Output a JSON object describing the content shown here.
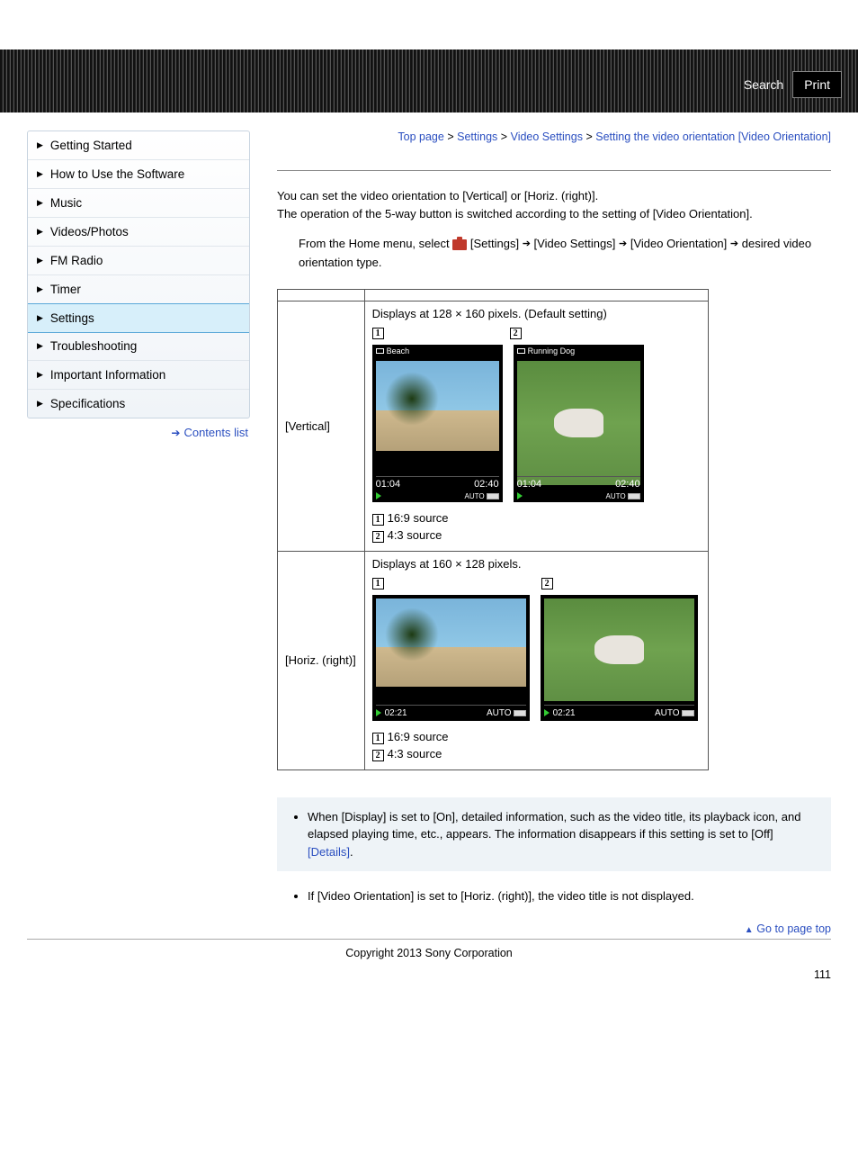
{
  "header": {
    "search": "Search",
    "print": "Print"
  },
  "breadcrumb": {
    "top": "Top page",
    "l1": "Settings",
    "l2": "Video Settings",
    "current": "Setting the video orientation [Video Orientation]",
    "sep": ">"
  },
  "sidebar": {
    "items": [
      "Getting Started",
      "How to Use the Software",
      "Music",
      "Videos/Photos",
      "FM Radio",
      "Timer",
      "Settings",
      "Troubleshooting",
      "Important Information",
      "Specifications"
    ],
    "active_index": 6,
    "contents_list": "Contents list"
  },
  "intro": {
    "l1": "You can set the video orientation to [Vertical] or [Horiz. (right)].",
    "l2": "The operation of the 5-way button is switched according to the setting of [Video Orientation]."
  },
  "step": {
    "p1": "From the Home menu, select ",
    "s1": "[Settings]",
    "s2": "[Video Settings]",
    "s3": "[Video Orientation]",
    "p2": "desired video orientation type."
  },
  "table": {
    "row1_label": "[Vertical]",
    "row1_desc": "Displays at 128 × 160 pixels. (Default setting)",
    "row2_label": "[Horiz. (right)]",
    "row2_desc": "Displays at 160 × 128 pixels.",
    "num1": "1",
    "num2": "2",
    "t_beach": "Beach",
    "t_dog": "Running Dog",
    "time_cur": "01:04",
    "time_tot": "02:40",
    "time_h": "02:21",
    "auto": "AUTO",
    "legend1": "16:9 source",
    "legend2": "4:3 source"
  },
  "hint_box": "When [Display] is set to [On], detailed information, such as the video title, its playback icon, and elapsed playing time, etc., appears. The information disappears if this setting is set to [Off] ",
  "details": "[Details]",
  "note_box": "If [Video Orientation] is set to [Horiz. (right)], the video title is not displayed.",
  "page_top": "Go to page top",
  "copyright": "Copyright 2013 Sony Corporation",
  "page_num": "111"
}
